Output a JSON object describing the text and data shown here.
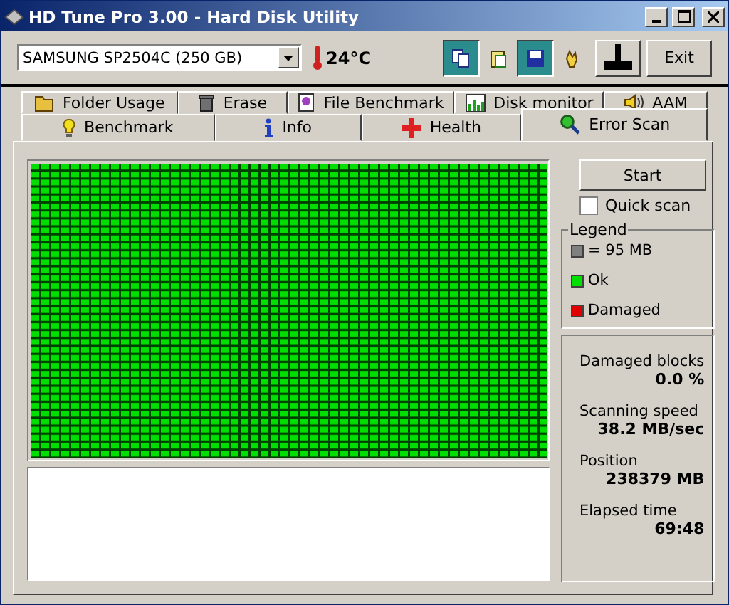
{
  "window": {
    "title": "HD Tune Pro 3.00 - Hard Disk Utility"
  },
  "drive_select": {
    "value": "SAMSUNG SP2504C (250 GB)"
  },
  "temperature": "24°C",
  "toolbar_buttons": [
    {
      "selected": true
    },
    {
      "selected": false
    },
    {
      "selected": true
    },
    {
      "selected": false
    },
    {
      "selected": false
    }
  ],
  "exit_button": "Exit",
  "tabs_top": [
    {
      "label": "Folder Usage",
      "selected": false
    },
    {
      "label": "Erase",
      "selected": false
    },
    {
      "label": "File Benchmark",
      "selected": false
    },
    {
      "label": "Disk monitor",
      "selected": false
    },
    {
      "label": "AAM",
      "selected": false
    }
  ],
  "tabs_bottom": [
    {
      "label": "Benchmark",
      "selected": false
    },
    {
      "label": "Info",
      "selected": false
    },
    {
      "label": "Health",
      "selected": false
    },
    {
      "label": "Error Scan",
      "selected": true
    }
  ],
  "start_button": "Start",
  "quick_scan": {
    "label": "Quick scan",
    "checked": false
  },
  "legend": {
    "title": "Legend",
    "items": [
      {
        "label": "= 95 MB",
        "color": "#808080"
      },
      {
        "label": "Ok",
        "color": "#00e000"
      },
      {
        "label": "Damaged",
        "color": "#e00000"
      }
    ]
  },
  "stats": [
    {
      "label": "Damaged blocks",
      "value": "0.0 %"
    },
    {
      "label": "Scanning speed",
      "value": "38.2 MB/sec"
    },
    {
      "label": "Position",
      "value": "238379 MB"
    },
    {
      "label": "Elapsed time",
      "value": "69:48"
    }
  ]
}
